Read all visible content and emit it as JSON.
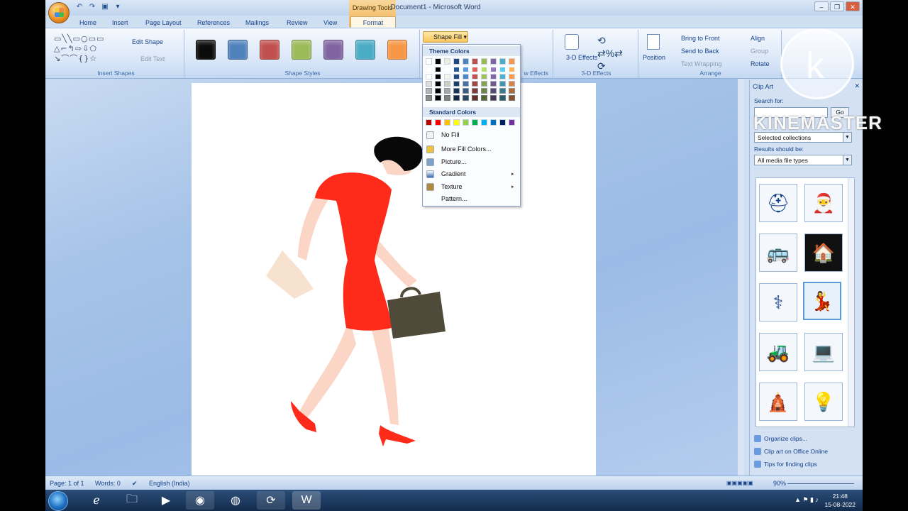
{
  "titlebar": {
    "context": "Drawing Tools",
    "title": "Document1 - Microsoft Word"
  },
  "tabs": [
    "Home",
    "Insert",
    "Page Layout",
    "References",
    "Mailings",
    "Review",
    "View",
    "Format"
  ],
  "ribbon": {
    "insert_shapes": {
      "label": "Insert Shapes",
      "edit_shape": "Edit Shape",
      "edit_text": "Edit Text"
    },
    "shape_styles": {
      "label": "Shape Styles",
      "swatches": [
        "#0b0b0b",
        "#4f81bd",
        "#c0504d",
        "#9bbb59",
        "#8064a2",
        "#4bacc6",
        "#f79646"
      ],
      "shape_fill": "Shape Fill"
    },
    "shadow_effects": {
      "label": "w Effects"
    },
    "threed": {
      "label": "3-D Effects",
      "button": "3-D Effects"
    },
    "arrange": {
      "label": "Arrange",
      "position": "Position",
      "bring_front": "Bring to Front",
      "send_back": "Send to Back",
      "text_wrap": "Text Wrapping",
      "align": "Align",
      "group": "Group",
      "rotate": "Rotate"
    }
  },
  "fill_menu": {
    "theme_colors": "Theme Colors",
    "standard_colors": "Standard Colors",
    "theme_top": [
      "#ffffff",
      "#000000",
      "#eeece1",
      "#1f497d",
      "#4f81bd",
      "#c0504d",
      "#9bbb59",
      "#8064a2",
      "#4bacc6",
      "#f79646"
    ],
    "standard": [
      "#c00000",
      "#ff0000",
      "#ffc000",
      "#ffff00",
      "#92d050",
      "#00b050",
      "#00b0f0",
      "#0070c0",
      "#002060",
      "#7030a0"
    ],
    "no_fill": "No Fill",
    "more": "More Fill Colors...",
    "picture": "Picture...",
    "gradient": "Gradient",
    "texture": "Texture",
    "pattern": "Pattern..."
  },
  "taskpane": {
    "title": "Clip Art",
    "search_for": "Search for:",
    "go": "Go",
    "search_in": "Selected collections",
    "results_label": "Results should be:",
    "results_value": "All media file types",
    "links": [
      "Organize clips...",
      "Clip art on Office Online",
      "Tips for finding clips"
    ]
  },
  "statusbar": {
    "page": "Page: 1 of 1",
    "words": "Words: 0",
    "language": "English (India)",
    "zoom": "90%"
  },
  "taskbar": {
    "time": "21:48",
    "date": "15-08-2022"
  },
  "watermark": "KINEMASTER",
  "colors": {
    "dress": "#ff2b1a",
    "hair": "#080808",
    "bag": "#4f4a3a",
    "skin": "#fbd5c5"
  }
}
